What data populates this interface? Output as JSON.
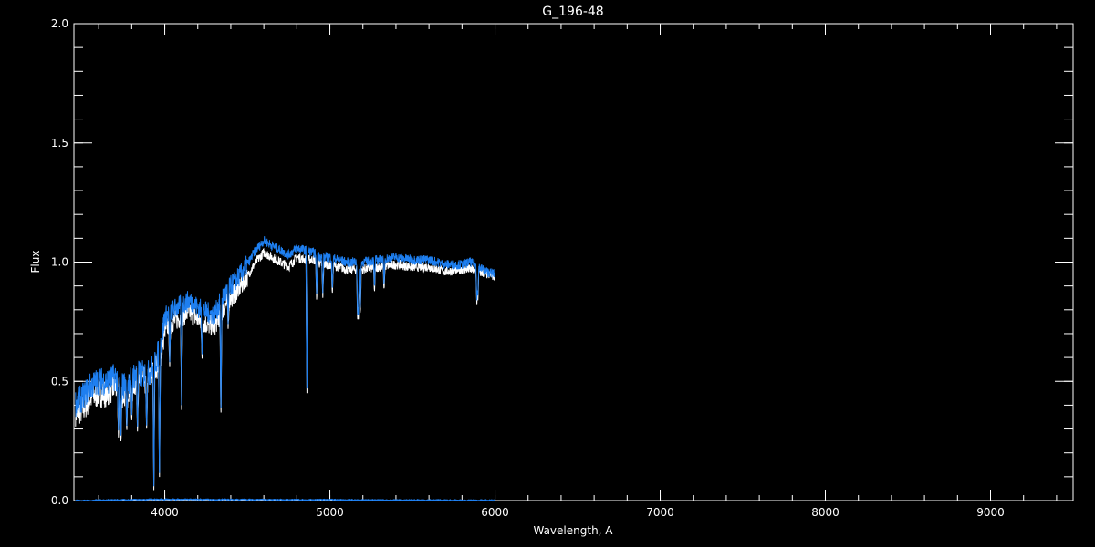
{
  "chart_data": {
    "type": "line",
    "title": "G_196-48",
    "xlabel": "Wavelength, A",
    "ylabel": "Flux",
    "xlim": [
      3450,
      9500
    ],
    "ylim": [
      0.0,
      2.0
    ],
    "x_ticks": [
      4000,
      5000,
      6000,
      7000,
      8000,
      9000
    ],
    "x_tick_labels": [
      "4000",
      "5000",
      "6000",
      "7000",
      "8000",
      "9000"
    ],
    "x_minor_step": 200,
    "y_ticks": [
      0.0,
      0.5,
      1.0,
      1.5,
      2.0
    ],
    "y_tick_labels": [
      "0.0",
      "0.5",
      "1.0",
      "1.5",
      "2.0"
    ],
    "y_minor_step": 0.1,
    "grid": false,
    "background": "#000000",
    "series": [
      {
        "color": "#ffffff",
        "x": [
          3460,
          3500,
          3550,
          3600,
          3650,
          3700,
          3750,
          3800,
          3850,
          3900,
          3950,
          3980,
          4000,
          4050,
          4100,
          4150,
          4200,
          4250,
          4300,
          4350,
          4400,
          4450,
          4500,
          4550,
          4600,
          4650,
          4700,
          4750,
          4800,
          4850,
          4900,
          4950,
          5000,
          5100,
          5200,
          5300,
          5400,
          5500,
          5600,
          5700,
          5800,
          5850,
          5900,
          5950,
          6000
        ],
        "y": [
          0.37,
          0.38,
          0.43,
          0.45,
          0.45,
          0.48,
          0.44,
          0.49,
          0.5,
          0.5,
          0.56,
          0.63,
          0.72,
          0.75,
          0.77,
          0.79,
          0.76,
          0.74,
          0.73,
          0.8,
          0.85,
          0.89,
          0.94,
          1.0,
          1.04,
          1.02,
          1.0,
          0.98,
          1.02,
          1.01,
          1.01,
          0.99,
          0.99,
          0.97,
          0.97,
          0.98,
          0.99,
          0.98,
          0.98,
          0.96,
          0.97,
          0.97,
          0.96,
          0.95,
          0.94
        ]
      },
      {
        "color": "#1e7ff0",
        "x": [
          3460,
          3500,
          3550,
          3600,
          3650,
          3700,
          3750,
          3800,
          3850,
          3900,
          3950,
          3980,
          4000,
          4050,
          4100,
          4150,
          4200,
          4250,
          4300,
          4350,
          4400,
          4450,
          4500,
          4550,
          4600,
          4650,
          4700,
          4750,
          4800,
          4850,
          4900,
          4950,
          5000,
          5100,
          5200,
          5300,
          5400,
          5500,
          5600,
          5700,
          5800,
          5850,
          5900,
          5950,
          6000
        ],
        "y": [
          0.41,
          0.43,
          0.48,
          0.5,
          0.5,
          0.52,
          0.48,
          0.52,
          0.53,
          0.53,
          0.59,
          0.67,
          0.77,
          0.8,
          0.82,
          0.84,
          0.81,
          0.79,
          0.78,
          0.85,
          0.9,
          0.94,
          0.99,
          1.05,
          1.09,
          1.07,
          1.05,
          1.03,
          1.06,
          1.05,
          1.04,
          1.02,
          1.02,
          1.0,
          1.0,
          1.01,
          1.02,
          1.01,
          1.01,
          0.99,
          0.99,
          1.0,
          0.98,
          0.96,
          0.95
        ]
      },
      {
        "color": "#1e7ff0",
        "x": [
          3460,
          4000,
          4500,
          5000,
          5500,
          6000
        ],
        "y": [
          0.0,
          0.005,
          0.004,
          0.003,
          0.002,
          0.001
        ]
      }
    ],
    "absorption_lines": [
      {
        "x": 3720,
        "depth_to": 0.27
      },
      {
        "x": 3735,
        "depth_to": 0.25
      },
      {
        "x": 3770,
        "depth_to": 0.3
      },
      {
        "x": 3800,
        "depth_to": 0.34
      },
      {
        "x": 3835,
        "depth_to": 0.31
      },
      {
        "x": 3890,
        "depth_to": 0.3
      },
      {
        "x": 3934,
        "depth_to": 0.06
      },
      {
        "x": 3968,
        "depth_to": 0.07
      },
      {
        "x": 4030,
        "depth_to": 0.58
      },
      {
        "x": 4102,
        "depth_to": 0.4
      },
      {
        "x": 4226,
        "depth_to": 0.6
      },
      {
        "x": 4340,
        "depth_to": 0.35
      },
      {
        "x": 4384,
        "depth_to": 0.74
      },
      {
        "x": 4861,
        "depth_to": 0.47
      },
      {
        "x": 4920,
        "depth_to": 0.85
      },
      {
        "x": 4957,
        "depth_to": 0.87
      },
      {
        "x": 5015,
        "depth_to": 0.88
      },
      {
        "x": 5168,
        "depth_to": 0.76
      },
      {
        "x": 5173,
        "depth_to": 0.78
      },
      {
        "x": 5184,
        "depth_to": 0.79
      },
      {
        "x": 5270,
        "depth_to": 0.89
      },
      {
        "x": 5328,
        "depth_to": 0.9
      },
      {
        "x": 5890,
        "depth_to": 0.84
      },
      {
        "x": 5896,
        "depth_to": 0.86
      }
    ]
  }
}
